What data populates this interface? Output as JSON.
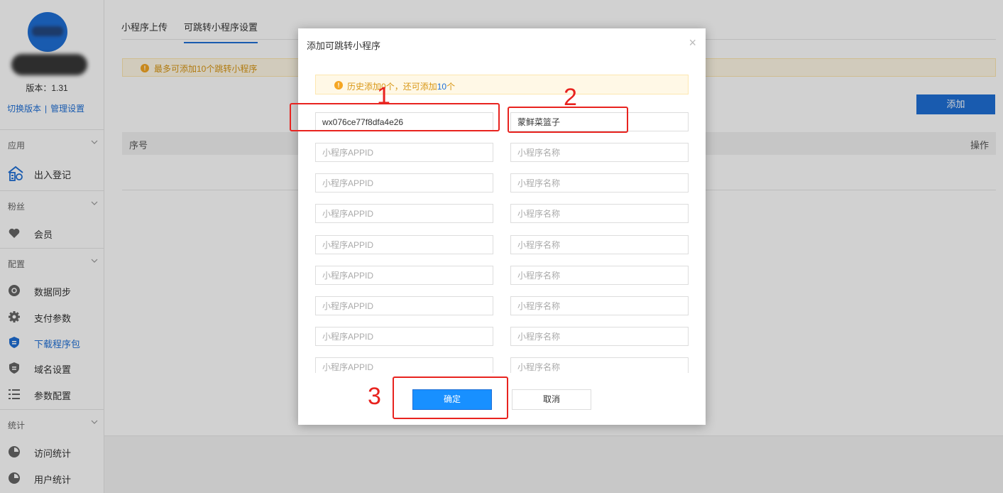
{
  "sidebar": {
    "version": "版本：1.31",
    "links": [
      "切换版本",
      "管理设置"
    ],
    "groups": [
      {
        "label": "应用",
        "items": [
          {
            "label": "出入登记",
            "icon": "building-icon"
          }
        ]
      },
      {
        "label": "粉丝",
        "items": [
          {
            "label": "会员",
            "icon": "heart-icon"
          }
        ]
      },
      {
        "label": "配置",
        "items": [
          {
            "label": "数据同步",
            "icon": "sync-icon"
          },
          {
            "label": "支付参数",
            "icon": "gear-icon"
          },
          {
            "label": "下载程序包",
            "icon": "shield-icon",
            "active": true
          },
          {
            "label": "域名设置",
            "icon": "shield-icon"
          },
          {
            "label": "参数配置",
            "icon": "list-icon"
          }
        ]
      },
      {
        "label": "统计",
        "items": [
          {
            "label": "访问统计",
            "icon": "pie-icon"
          },
          {
            "label": "用户统计",
            "icon": "pie-icon"
          }
        ]
      }
    ]
  },
  "main": {
    "tabs": [
      {
        "label": "小程序上传"
      },
      {
        "label": "可跳转小程序设置",
        "active": true
      }
    ],
    "notice": "最多可添加10个跳转小程序",
    "add_label": "添加",
    "table": {
      "col_index": "序号",
      "col_action": "操作"
    }
  },
  "modal": {
    "title": "添加可跳转小程序",
    "close": "×",
    "tip_prefix": "历史添加",
    "tip_count": "0",
    "tip_middle": "个，还可添加",
    "tip_remaining": "10",
    "tip_suffix": "个",
    "appid_placeholder": "小程序APPID",
    "name_placeholder": "小程序名称",
    "rows": [
      {
        "appid": "wx076ce77f8dfa4e26",
        "name": "蒙鲜菜篮子"
      },
      {
        "appid": "",
        "name": ""
      },
      {
        "appid": "",
        "name": ""
      },
      {
        "appid": "",
        "name": ""
      },
      {
        "appid": "",
        "name": ""
      },
      {
        "appid": "",
        "name": ""
      },
      {
        "appid": "",
        "name": ""
      },
      {
        "appid": "",
        "name": ""
      },
      {
        "appid": "",
        "name": ""
      }
    ],
    "confirm_label": "确定",
    "cancel_label": "取消"
  },
  "annotations": [
    "1",
    "2",
    "3"
  ],
  "colors": {
    "accent": "#1f6fd6",
    "annotation": "#e8231f",
    "warning": "#d89614"
  }
}
